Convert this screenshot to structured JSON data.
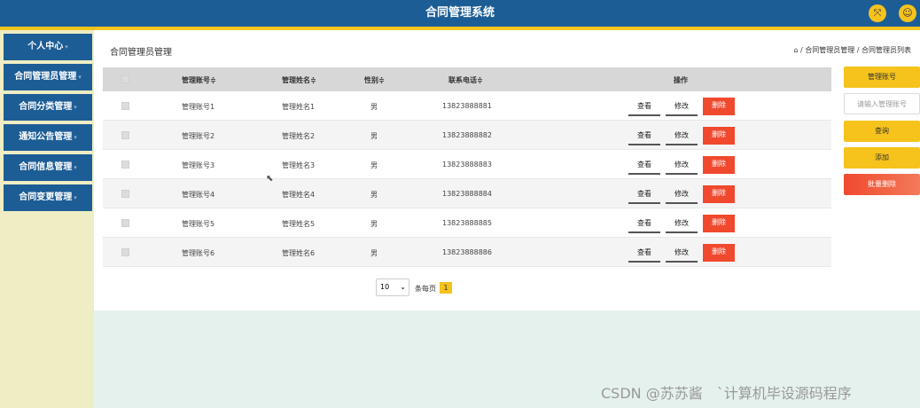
{
  "header": {
    "title": "合同管理系统",
    "icon_left": "fullscreen-icon",
    "icon_right": "user-icon"
  },
  "sidebar": {
    "items": [
      {
        "label": "个人中心"
      },
      {
        "label": "合同管理员管理"
      },
      {
        "label": "合同分类管理"
      },
      {
        "label": "通知公告管理"
      },
      {
        "label": "合同信息管理"
      },
      {
        "label": "合同变更管理"
      }
    ]
  },
  "page": {
    "title": "合同管理员管理",
    "breadcrumb": "/ 合同管理员管理 / 合同管理员列表"
  },
  "table": {
    "headers": [
      "管理账号≑",
      "管理姓名≑",
      "性别≑",
      "联系电话≑",
      "操作"
    ],
    "rows": [
      {
        "account": "管理账号1",
        "name": "管理姓名1",
        "gender": "男",
        "phone": "13823888881"
      },
      {
        "account": "管理账号2",
        "name": "管理姓名2",
        "gender": "男",
        "phone": "13823888882"
      },
      {
        "account": "管理账号3",
        "name": "管理姓名3",
        "gender": "男",
        "phone": "13823888883"
      },
      {
        "account": "管理账号4",
        "name": "管理姓名4",
        "gender": "男",
        "phone": "13823888884"
      },
      {
        "account": "管理账号5",
        "name": "管理姓名5",
        "gender": "男",
        "phone": "13823888885"
      },
      {
        "account": "管理账号6",
        "name": "管理姓名6",
        "gender": "男",
        "phone": "13823888886"
      }
    ],
    "actions": {
      "view": "查看",
      "edit": "修改",
      "delete": "删除"
    }
  },
  "right_panel": {
    "label": "管理账号",
    "input_placeholder": "请输入管理账号",
    "search": "查询",
    "add": "添加",
    "batch_delete": "批量删除"
  },
  "pagination": {
    "page_size": "10",
    "per_page_label": "条每页",
    "current_page": "1"
  },
  "watermark": "CSDN @苏苏酱　`计算机毕设源码程序",
  "colors": {
    "primary": "#1d5d96",
    "accent": "#f5c31c",
    "danger": "#f0492e",
    "sidebar_bg": "#eeedc3"
  }
}
